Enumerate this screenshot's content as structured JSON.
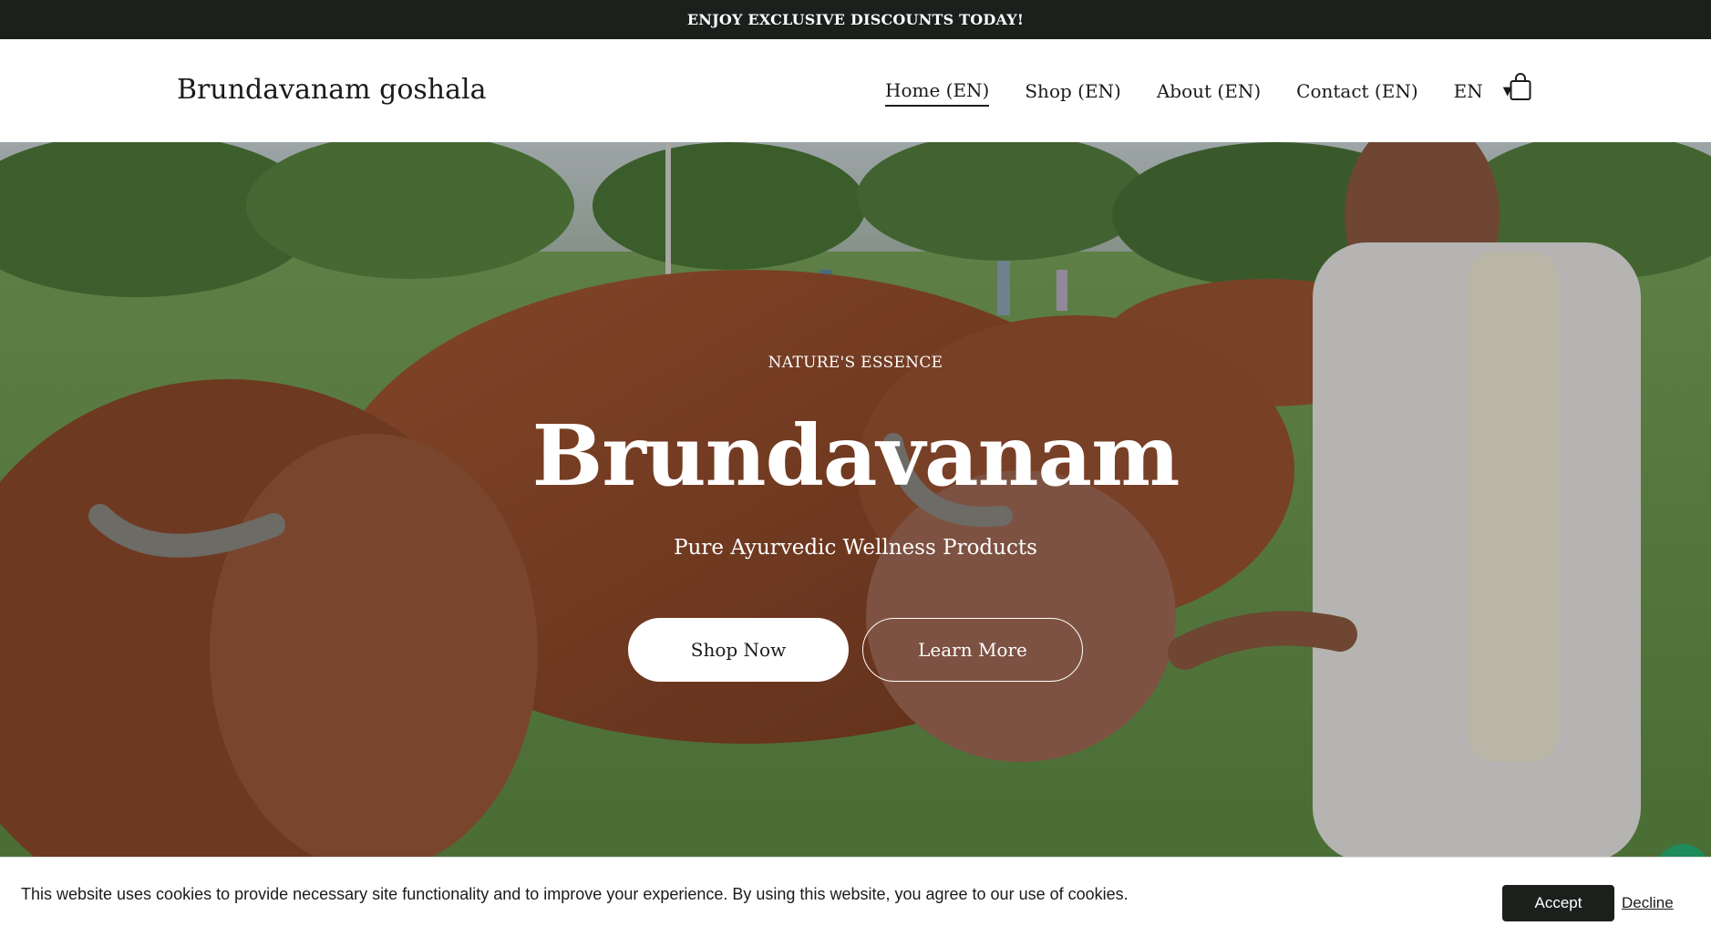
{
  "announcement": {
    "text": "ENJOY EXCLUSIVE DISCOUNTS TODAY!"
  },
  "header": {
    "logo": "Brundavanam goshala",
    "nav": [
      {
        "label": "Home (EN)",
        "active": true
      },
      {
        "label": "Shop (EN)",
        "active": false
      },
      {
        "label": "About (EN)",
        "active": false
      },
      {
        "label": "Contact (EN)",
        "active": false
      }
    ],
    "language": {
      "label": "EN",
      "icon": "caret-down-icon"
    },
    "cart_icon": "shopping-bag-icon"
  },
  "hero": {
    "eyebrow": "NATURE'S ESSENCE",
    "title": "Brundavanam",
    "subtitle": "Pure Ayurvedic Wellness Products",
    "buttons": {
      "primary": "Shop Now",
      "secondary": "Learn More"
    }
  },
  "cookie_banner": {
    "text": "This website uses cookies to provide necessary site functionality and to improve your experience. By using this website, you agree to our use of cookies.",
    "accept": "Accept",
    "decline": "Decline"
  },
  "colors": {
    "announcement_bg": "#1b201d",
    "text": "#1b1b1b",
    "accept_bg": "#1b201d",
    "chat_bubble": "#1f8a5a"
  }
}
